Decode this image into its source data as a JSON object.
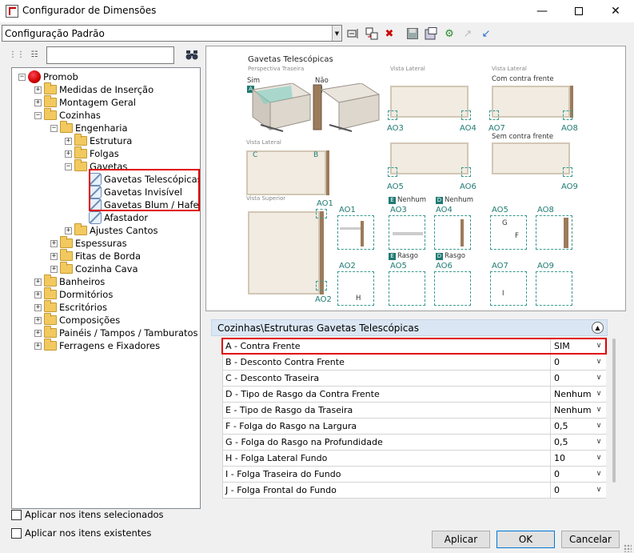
{
  "window": {
    "title": "Configurador de Dimensões",
    "minimize_icon": "minimize-icon",
    "maximize_icon": "maximize-icon",
    "close_icon": "close-icon"
  },
  "config": {
    "selected": "Configuração Padrão"
  },
  "toolbar_icons": [
    "rename-icon",
    "copy-icon",
    "delete-icon",
    "save-icon",
    "export-icon",
    "settings-icon",
    "disabled-link-icon",
    "link-icon"
  ],
  "tree": {
    "search_value": "",
    "nodes": [
      {
        "label": "Promob",
        "exp": "-",
        "icon": "globe"
      },
      {
        "label": "Medidas de Inserção",
        "exp": "+",
        "icon": "folder"
      },
      {
        "label": "Montagem Geral",
        "exp": "+",
        "icon": "folder"
      },
      {
        "label": "Cozinhas",
        "exp": "-",
        "icon": "folder"
      },
      {
        "label": "Engenharia",
        "exp": "-",
        "icon": "folder"
      },
      {
        "label": "Estrutura",
        "exp": "+",
        "icon": "folder"
      },
      {
        "label": "Folgas",
        "exp": "+",
        "icon": "folder"
      },
      {
        "label": "Gavetas",
        "exp": "-",
        "icon": "folder"
      },
      {
        "label": "Gavetas Telescópicas",
        "exp": "",
        "icon": "leaf"
      },
      {
        "label": "Gavetas Invisível",
        "exp": "",
        "icon": "leaf"
      },
      {
        "label": "Gavetas Blum / Hafele",
        "exp": "",
        "icon": "leaf"
      },
      {
        "label": "Afastador",
        "exp": "",
        "icon": "leaf"
      },
      {
        "label": "Ajustes Cantos",
        "exp": "+",
        "icon": "folder"
      },
      {
        "label": "Espessuras",
        "exp": "+",
        "icon": "folder"
      },
      {
        "label": "Fitas de Borda",
        "exp": "+",
        "icon": "folder"
      },
      {
        "label": "Cozinha Cava",
        "exp": "+",
        "icon": "folder"
      },
      {
        "label": "Banheiros",
        "exp": "+",
        "icon": "folder"
      },
      {
        "label": "Dormitórios",
        "exp": "+",
        "icon": "folder"
      },
      {
        "label": "Escritórios",
        "exp": "+",
        "icon": "folder"
      },
      {
        "label": "Composições",
        "exp": "+",
        "icon": "folder"
      },
      {
        "label": "Painéis / Tampos / Tamburatos",
        "exp": "+",
        "icon": "folder"
      },
      {
        "label": "Ferragens e Fixadores",
        "exp": "+",
        "icon": "folder"
      }
    ]
  },
  "preview": {
    "title": "Gavetas Telescópicas",
    "subtitle": "Perspectiva Traseira",
    "sim": "Sim",
    "nao": "Não",
    "badge_a": "A",
    "badge_b": "B",
    "badge_c": "C",
    "badge_d": "D",
    "badge_e": "E",
    "vista_lateral": "Vista Lateral",
    "vista_superior": "Vista Superior",
    "com_contra_frente": "Com contra frente",
    "sem_contra_frente": "Sem contra frente",
    "nenhum": "Nenhum",
    "rasgo": "Rasgo",
    "label_f": "F",
    "label_g": "G",
    "label_h": "H",
    "label_i": "I",
    "ao": [
      "AO1",
      "AO2",
      "AO3",
      "AO4",
      "AO5",
      "AO6",
      "AO7",
      "AO8",
      "AO9"
    ]
  },
  "grid": {
    "header": "Cozinhas\\Estruturas Gavetas Telescópicas",
    "rows": [
      {
        "name": "A - Contra Frente",
        "value": "SIM"
      },
      {
        "name": "B - Desconto Contra Frente",
        "value": "0"
      },
      {
        "name": "C - Desconto Traseira",
        "value": "0"
      },
      {
        "name": "D - Tipo de Rasgo da Contra Frente",
        "value": "Nenhum"
      },
      {
        "name": "E - Tipo de Rasgo da Traseira",
        "value": "Nenhum"
      },
      {
        "name": "F - Folga do Rasgo na Largura",
        "value": "0,5"
      },
      {
        "name": "G - Folga do Rasgo na Profundidade",
        "value": "0,5"
      },
      {
        "name": "H - Folga Lateral Fundo",
        "value": "10"
      },
      {
        "name": "I - Folga Traseira do Fundo",
        "value": "0"
      },
      {
        "name": "J - Folga Frontal do Fundo",
        "value": "0"
      }
    ]
  },
  "options": {
    "apply_selected": "Aplicar nos itens selecionados",
    "apply_existing": "Aplicar nos itens existentes"
  },
  "buttons": {
    "apply": "Aplicar",
    "ok": "OK",
    "cancel": "Cancelar"
  }
}
